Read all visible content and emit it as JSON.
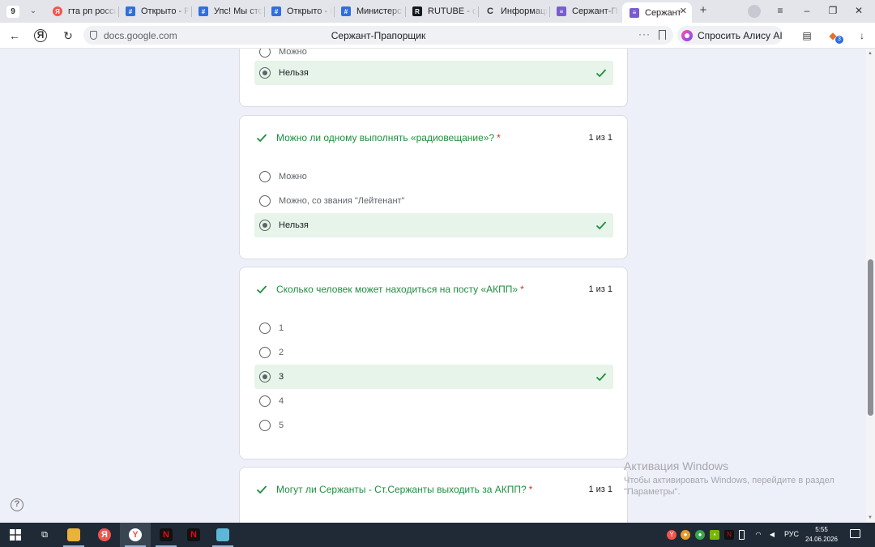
{
  "browser": {
    "tab_count": "9",
    "tabs": [
      {
        "title": "гта рп росси",
        "favicon": "yandex-icon",
        "color": "#f2544c",
        "glyph": "Я"
      },
      {
        "title": "Открыто - Р",
        "favicon": "grid-icon",
        "color": "#2f6fde",
        "glyph": "#"
      },
      {
        "title": "Упс! Мы сто",
        "favicon": "grid-icon",
        "color": "#2f6fde",
        "glyph": "#"
      },
      {
        "title": "Открыто - Р",
        "favicon": "grid-icon",
        "color": "#2f6fde",
        "glyph": "#"
      },
      {
        "title": "Министерст",
        "favicon": "grid-icon",
        "color": "#2f6fde",
        "glyph": "#"
      },
      {
        "title": "RUTUBE - сл",
        "favicon": "rutube-icon",
        "color": "#14191f",
        "glyph": "R"
      },
      {
        "title": "Информаци",
        "favicon": "loading-icon",
        "color": "#ffffff",
        "glyph": "C"
      },
      {
        "title": "Сержант-Пр",
        "favicon": "forms-icon",
        "color": "#7a5ccf",
        "glyph": "≡"
      },
      {
        "title": "Сержант",
        "favicon": "forms-icon",
        "color": "#7a5ccf",
        "glyph": "≡",
        "active": true
      }
    ],
    "address": "docs.google.com",
    "page_title": "Сержант-Прапорщик",
    "alice_label": "Спросить Алису AI",
    "extension_badge": "3"
  },
  "form": {
    "prev_question": {
      "options": [
        {
          "label": "Можно",
          "selected": false,
          "correct": false
        },
        {
          "label": "Нельзя",
          "selected": true,
          "correct": true
        }
      ]
    },
    "questions": [
      {
        "title": "Можно ли одному выполнять «радиовещание»?",
        "required": "*",
        "score": "1 из 1",
        "options": [
          {
            "label": "Можно",
            "selected": false,
            "correct": false
          },
          {
            "label": "Можно, со звания \"Лейтенант\"",
            "selected": false,
            "correct": false
          },
          {
            "label": "Нельзя",
            "selected": true,
            "correct": true
          }
        ]
      },
      {
        "title": "Сколько человек может находиться на посту «АКПП»",
        "required": "*",
        "score": "1 из 1",
        "options": [
          {
            "label": "1",
            "selected": false,
            "correct": false
          },
          {
            "label": "2",
            "selected": false,
            "correct": false
          },
          {
            "label": "3",
            "selected": true,
            "correct": true
          },
          {
            "label": "4",
            "selected": false,
            "correct": false
          },
          {
            "label": "5",
            "selected": false,
            "correct": false
          }
        ]
      },
      {
        "title": "Могут ли  Сержанты - Ст.Сержанты выходить за АКПП?",
        "required": "*",
        "score": "1 из 1",
        "options": []
      }
    ]
  },
  "help_glyph": "?",
  "activation": {
    "title": "Активация Windows",
    "subtitle": "Чтобы активировать Windows, перейдите в раздел \"Параметры\"."
  },
  "taskbar": {
    "language": "РУС",
    "time": "5:55",
    "date": "24.06.2026"
  },
  "colors": {
    "correct_green": "#1e8e3e",
    "correct_bg": "#e6f4ea",
    "required_red": "#d93025",
    "page_bg": "#eef0f9"
  }
}
